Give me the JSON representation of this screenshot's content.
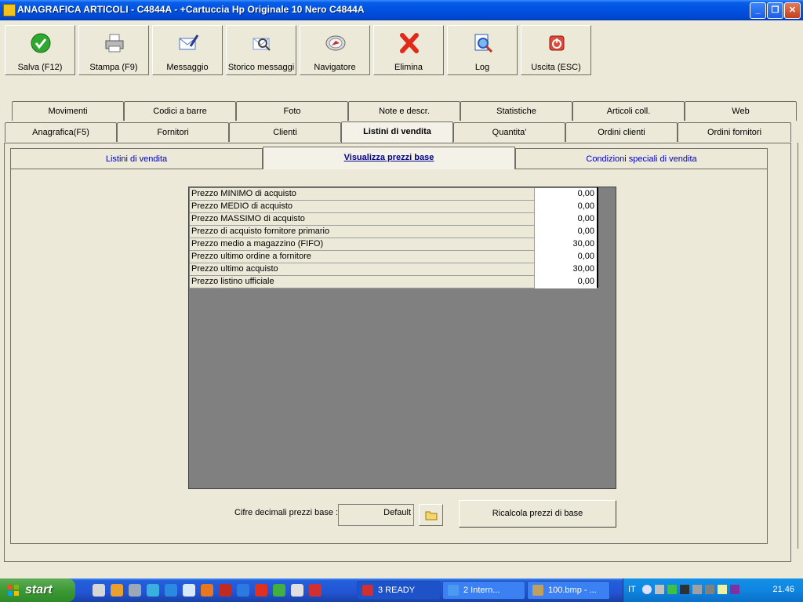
{
  "window": {
    "title": "ANAGRAFICA ARTICOLI - C4844A - +Cartuccia Hp Originale 10 Nero C4844A",
    "minimize": "_",
    "restore": "❐",
    "close": "✕"
  },
  "toolbar": [
    {
      "label": "Salva (F12)",
      "icon": "save-check-icon",
      "color": "#2fa82f"
    },
    {
      "label": "Stampa (F9)",
      "icon": "printer-icon",
      "color": "#8a8a8a"
    },
    {
      "label": "Messaggio",
      "icon": "envelope-pen-icon",
      "color": "#4a72c8"
    },
    {
      "label": "Storico messaggi",
      "icon": "envelope-search-icon",
      "color": "#7a9ad8"
    },
    {
      "label": "Navigatore",
      "icon": "compass-icon",
      "color": "#c03030"
    },
    {
      "label": "Elimina",
      "icon": "delete-x-icon",
      "color": "#e02a1a"
    },
    {
      "label": "Log",
      "icon": "log-search-icon",
      "color": "#2a5ab8"
    },
    {
      "label": "Uscita (ESC)",
      "icon": "exit-power-icon",
      "color": "#e04a3a"
    }
  ],
  "tabs_row1": [
    "Movimenti",
    "Codici a barre",
    "Foto",
    "Note e descr.",
    "Statistiche",
    "Articoli coll.",
    "Web"
  ],
  "tabs_row2": [
    "Anagrafica(F5)",
    "Fornitori",
    "Clienti",
    "Listini di vendita",
    "Quantita'",
    "Ordini clienti",
    "Ordini fornitori"
  ],
  "active_tab": "Listini di vendita",
  "subtabs": [
    "Listini di vendita",
    "Visualizza prezzi base",
    "Condizioni speciali di vendita"
  ],
  "active_subtab": "Visualizza prezzi base",
  "prices": [
    {
      "label": "Prezzo MINIMO di acquisto",
      "value": "0,00"
    },
    {
      "label": "Prezzo MEDIO di acquisto",
      "value": "0,00"
    },
    {
      "label": "Prezzo MASSIMO di acquisto",
      "value": "0,00"
    },
    {
      "label": "Prezzo di acquisto fornitore primario",
      "value": "0,00"
    },
    {
      "label": "Prezzo medio a magazzino (FIFO)",
      "value": "30,00"
    },
    {
      "label": "Prezzo ultimo ordine a fornitore",
      "value": "0,00"
    },
    {
      "label": "Prezzo ultimo acquisto",
      "value": "30,00"
    },
    {
      "label": "Prezzo listino ufficiale",
      "value": "0,00"
    }
  ],
  "decimals": {
    "label": "Cifre decimali prezzi base :",
    "value": "Default"
  },
  "recalc_button": "Ricalcola prezzi di base",
  "taskbar": {
    "start": "start",
    "tasks": [
      "3 READY",
      "2 Intern...",
      "100.bmp - ..."
    ],
    "lang": "IT",
    "clock": "21.46"
  }
}
